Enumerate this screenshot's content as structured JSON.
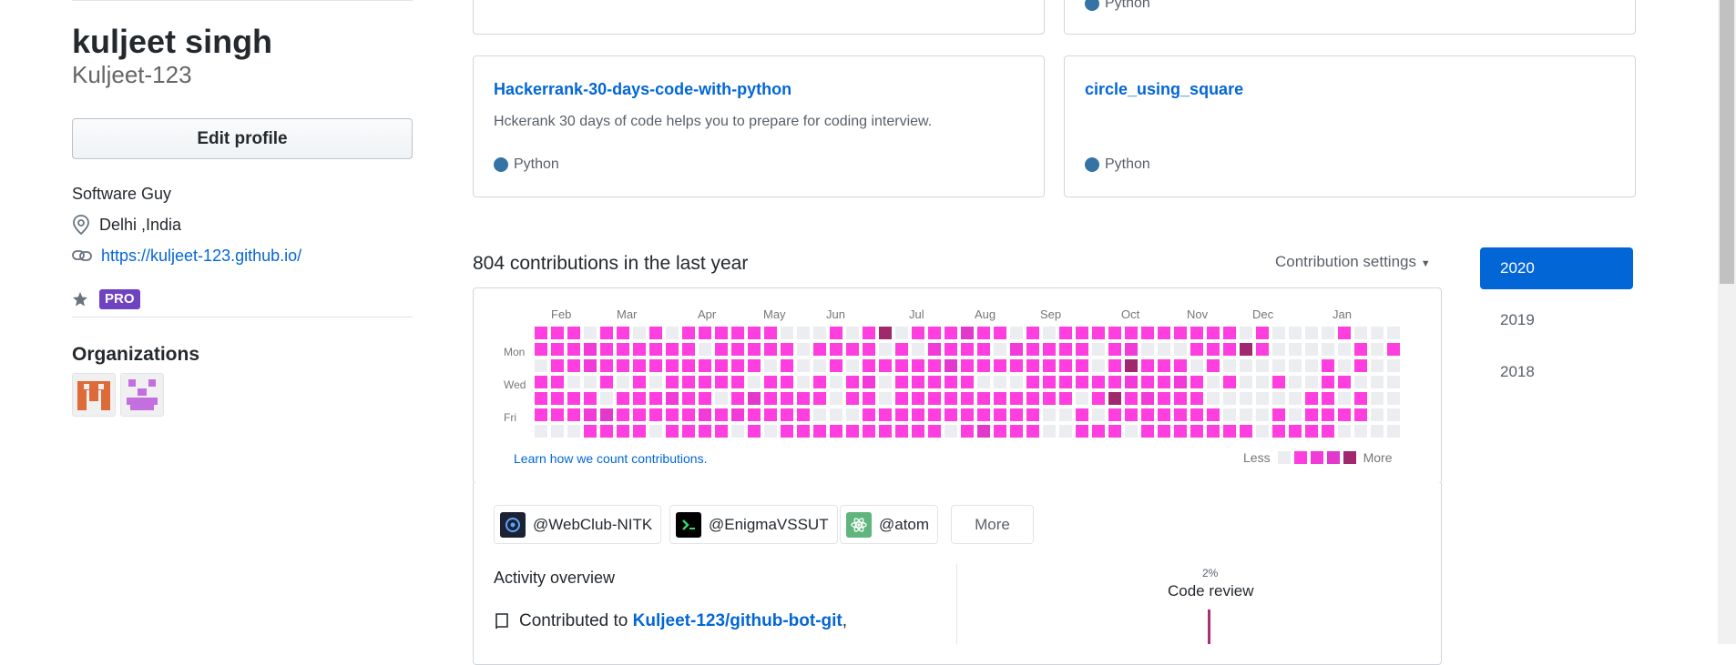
{
  "profile": {
    "name": "kuljeet singh",
    "username": "Kuljeet-123",
    "edit_profile": "Edit profile",
    "bio": "Software Guy",
    "location": "Delhi ,India",
    "website": "https://kuljeet-123.github.io/",
    "pro_badge": "PRO",
    "organizations_title": "Organizations"
  },
  "repos": [
    {
      "language": "Python"
    },
    {
      "name": "Hackerrank-30-days-code-with-python",
      "description": "Hckerank 30 days of code helps you to prepare for coding interview.",
      "language": "Python"
    },
    {
      "name": "circle_using_square",
      "description": "",
      "language": "Python"
    }
  ],
  "language_color": "#3572A5",
  "contributions": {
    "title": "804 contributions in the last year",
    "settings": "Contribution settings",
    "months": [
      "Feb",
      "Mar",
      "Apr",
      "May",
      "Jun",
      "Jul",
      "Aug",
      "Sep",
      "Oct",
      "Nov",
      "Dec",
      "Jan"
    ],
    "days": [
      "Mon",
      "Wed",
      "Fri"
    ],
    "learn_link": "Learn how we count contributions.",
    "legend_less": "Less",
    "legend_more": "More",
    "colors": [
      "#ebedf0",
      "#ff3ee0",
      "#f23ad8",
      "#e338cc",
      "#a0296e"
    ]
  },
  "org_filters": [
    "@WebClub-NITK",
    "@EnigmaVSSUT",
    "@atom"
  ],
  "more_button": "More",
  "activity": {
    "title": "Activity overview",
    "contributed_prefix": "Contributed to",
    "repo1": "Kuljeet-123/github-bot-git",
    "code_review_pct": "2%",
    "code_review_label": "Code review"
  },
  "years": [
    "2020",
    "2019",
    "2018"
  ]
}
